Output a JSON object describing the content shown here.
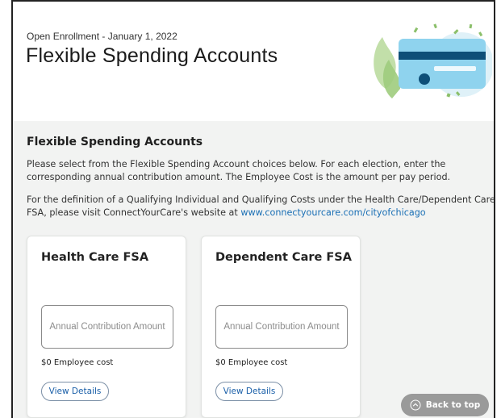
{
  "header": {
    "subtitle": "Open Enrollment - January 1, 2022",
    "title": "Flexible Spending Accounts"
  },
  "section": {
    "title": "Flexible Spending Accounts",
    "paragraph1": "Please select from the Flexible Spending Account choices below. For each election, enter the corresponding annual contribution amount. The Employee Cost is the amount per pay period.",
    "paragraph2_text": "For the definition of a Qualifying Individual and Qualifying Costs under the Health Care/Dependent Care FSA, please visit ConnectYourCare's website at ",
    "paragraph2_link": "www.connectyourcare.com/cityofchicago"
  },
  "cards": [
    {
      "title": "Health Care FSA",
      "input_placeholder": "Annual Contribution Amount",
      "input_value": "",
      "employee_cost": "$0 Employee cost",
      "button_label": "View Details"
    },
    {
      "title": "Dependent Care FSA",
      "input_placeholder": "Annual Contribution Amount",
      "input_value": "",
      "employee_cost": "$0 Employee cost",
      "button_label": "View Details"
    }
  ],
  "back_to_top": {
    "label": "Back to top",
    "icon": "chevron-up-circle-icon"
  },
  "colors": {
    "accent": "#1a6fb5",
    "card_illustration": "#8fd3ee",
    "card_stripe": "#0e4f78",
    "leaf_green": "#a8d08d",
    "content_bg": "#f2f3f2"
  }
}
